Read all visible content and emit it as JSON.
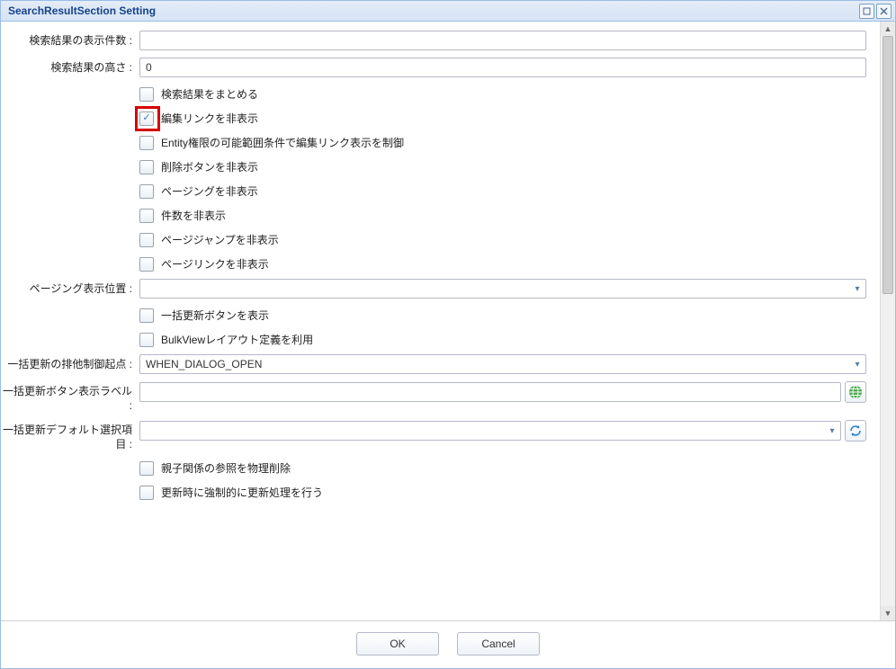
{
  "window": {
    "title": "SearchResultSection Setting"
  },
  "form": {
    "display_count": {
      "label": "検索結果の表示件数 :",
      "value": ""
    },
    "result_height": {
      "label": "検索結果の高さ :",
      "value": "0"
    },
    "checks1": {
      "group_results": {
        "label": "検索結果をまとめる",
        "checked": false
      },
      "hide_edit_link": {
        "label": "編集リンクを非表示",
        "checked": true
      },
      "entity_perm_edit_link": {
        "label": "Entity権限の可能範囲条件で編集リンク表示を制御",
        "checked": false
      },
      "hide_delete_btn": {
        "label": "削除ボタンを非表示",
        "checked": false
      },
      "hide_paging": {
        "label": "ページングを非表示",
        "checked": false
      },
      "hide_count": {
        "label": "件数を非表示",
        "checked": false
      },
      "hide_page_jump": {
        "label": "ページジャンプを非表示",
        "checked": false
      },
      "hide_page_link": {
        "label": "ページリンクを非表示",
        "checked": false
      }
    },
    "paging_position": {
      "label": "ページング表示位置 :",
      "value": ""
    },
    "checks2": {
      "show_bulk_update_btn": {
        "label": "一括更新ボタンを表示",
        "checked": false
      },
      "bulkview_layout": {
        "label": "BulkViewレイアウト定義を利用",
        "checked": false
      }
    },
    "bulk_excl_start": {
      "label": "一括更新の排他制御起点 :",
      "value": "WHEN_DIALOG_OPEN"
    },
    "bulk_btn_label": {
      "label": "一括更新ボタン表示ラベル :",
      "value": ""
    },
    "bulk_default_sel": {
      "label": "一括更新デフォルト選択項目 :",
      "value": ""
    },
    "checks3": {
      "purge_parent_child_ref": {
        "label": "親子関係の参照を物理削除",
        "checked": false
      },
      "force_update_on_update": {
        "label": "更新時に強制的に更新処理を行う",
        "checked": false
      }
    }
  },
  "buttons": {
    "ok": "OK",
    "cancel": "Cancel"
  }
}
